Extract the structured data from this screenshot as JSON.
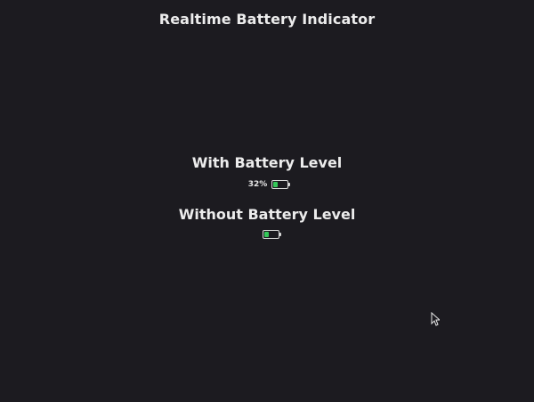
{
  "app": {
    "title": "Realtime Battery Indicator"
  },
  "sections": [
    {
      "heading": "With Battery Level",
      "battery": {
        "level_text": "32%",
        "level_fraction": 0.32,
        "fill_color": "#34c759"
      }
    },
    {
      "heading": "Without Battery Level",
      "battery": {
        "level_fraction": 0.32,
        "fill_color": "#34c759"
      }
    }
  ],
  "icons": {
    "battery": "battery-icon",
    "cursor": "mouse-pointer-icon"
  },
  "colors": {
    "background": "#1c1b20",
    "text": "#ececec",
    "accent": "#34c759"
  }
}
